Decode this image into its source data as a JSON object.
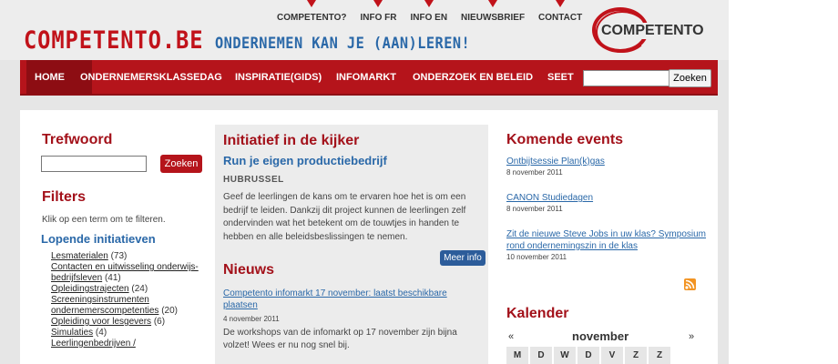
{
  "header": {
    "logo_text": "COMPETENTO.BE",
    "tagline": "ONDERNEMEN KAN JE (AAN)LEREN!",
    "brand_badge": "COMPETENTO",
    "top_links": [
      "COMPETENTO?",
      "INFO FR",
      "INFO EN",
      "NIEUWSBRIEF",
      "CONTACT"
    ]
  },
  "nav": {
    "items": [
      "HOME",
      "ONDERNEMERSKLASSEDAG",
      "INSPIRATIE(GIDS)",
      "INFOMARKT",
      "ONDERZOEK EN BELEID",
      "SEET"
    ],
    "search_button": "Zoeken",
    "search_value": ""
  },
  "left": {
    "trefwoord_title": "Trefwoord",
    "trefwoord_value": "",
    "trefwoord_button": "Zoeken",
    "filters_title": "Filters",
    "filters_hint": "Klik op een term om te filteren.",
    "lopende_title": "Lopende initiatieven",
    "filters": [
      {
        "label": "Lesmaterialen",
        "count": "(73)"
      },
      {
        "label": "Contacten en uitwisseling onderwijs-bedrijfsleven",
        "count": "(41)"
      },
      {
        "label": "Opleidingstrajecten",
        "count": "(24)"
      },
      {
        "label": "Screeningsinstrumenten ondernemerscompetenties",
        "count": "(20)"
      },
      {
        "label": "Opleiding voor lesgevers",
        "count": "(6)"
      },
      {
        "label": "Simulaties",
        "count": "(4)"
      },
      {
        "label": "Leerlingenbedrijven /",
        "count": ""
      }
    ]
  },
  "middle": {
    "initiatief_title": "Initiatief in de kijker",
    "initiatief_link": "Run je eigen productiebedrijf",
    "initiatief_org": "HUBRUSSEL",
    "initiatief_body": "Geef de leerlingen de kans om te ervaren hoe het is om een bedrijf te leiden. Dankzij dit project kunnen de leerlingen zelf ondervinden wat het betekent om de touwtjes in handen te hebben en alle beleidsbeslissingen te nemen.",
    "meer_info": "Meer info",
    "nieuws_title": "Nieuws",
    "news_link": "Competento infomarkt 17 november: laatst beschikbare plaatsen",
    "news_date": "4 november 2011",
    "news_body": "De workshops van de infomarkt op 17 november zijn bijna volzet! Wees er nu nog snel bij."
  },
  "right": {
    "events_title": "Komende events",
    "events": [
      {
        "title": "Ontbijtsessie Plan(k)gas",
        "date": "8 november 2011"
      },
      {
        "title": "CANON Studiedagen",
        "date": "8 november 2011"
      },
      {
        "title": "Zit de nieuwe Steve Jobs in uw klas? Symposium rond ondernemingszin in de klas",
        "date": "10 november 2011"
      }
    ],
    "kalender_title": "Kalender",
    "calendar": {
      "prev": "«",
      "month": "november",
      "next": "»",
      "days": [
        "M",
        "D",
        "W",
        "D",
        "V",
        "Z",
        "Z"
      ]
    }
  }
}
